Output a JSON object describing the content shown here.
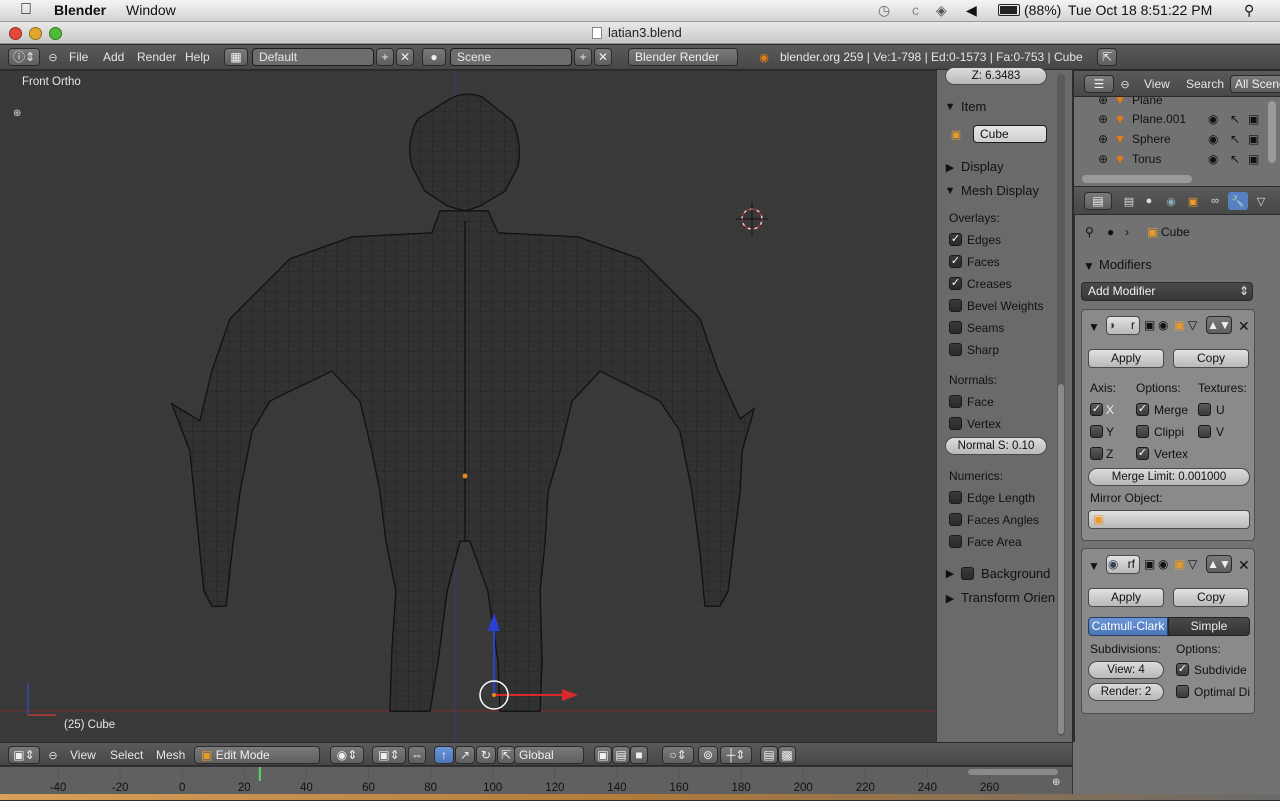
{
  "mac_menubar": {
    "app_name": "Blender",
    "menu_window": "Window",
    "battery": "(88%)",
    "clock": "Tue Oct 18  8:51:22 PM"
  },
  "window": {
    "title": "latian3.blend"
  },
  "info_header": {
    "menus": [
      "File",
      "Add",
      "Render",
      "Help"
    ],
    "layout": "Default",
    "scene": "Scene",
    "engine": "Blender Render",
    "stats": "blender.org 259 | Ve:1-798 | Ed:0-1573 | Fa:0-753 | Cube"
  },
  "viewport": {
    "view_name": "Front Ortho",
    "object_label": "(25) Cube"
  },
  "n_panel": {
    "top_field": "Z: 6.3483",
    "item_header": "Item",
    "item_name": "Cube",
    "display_header": "Display",
    "mesh_display_header": "Mesh Display",
    "overlays_label": "Overlays:",
    "overlays": [
      {
        "label": "Edges",
        "checked": true
      },
      {
        "label": "Faces",
        "checked": true
      },
      {
        "label": "Creases",
        "checked": true
      },
      {
        "label": "Bevel Weights",
        "checked": false
      },
      {
        "label": "Seams",
        "checked": false
      },
      {
        "label": "Sharp",
        "checked": false
      }
    ],
    "normals_label": "Normals:",
    "normals": [
      {
        "label": "Face",
        "checked": false
      },
      {
        "label": "Vertex",
        "checked": false
      }
    ],
    "normal_size": "Normal S: 0.10",
    "numerics_label": "Numerics:",
    "numerics": [
      {
        "label": "Edge Length",
        "checked": false
      },
      {
        "label": "Faces Angles",
        "checked": false
      },
      {
        "label": "Face Area",
        "checked": false
      }
    ],
    "background_header": "Background I",
    "transform_header": "Transform Orient"
  },
  "outliner": {
    "menus": [
      "View",
      "Search"
    ],
    "filter": "All Scene",
    "items": [
      "Plane",
      "Plane.001",
      "Sphere",
      "Torus"
    ]
  },
  "properties": {
    "breadcrumb": "Cube",
    "modifiers_header": "Modifiers",
    "add_modifier": "Add Modifier",
    "mirror": {
      "name_short": "r",
      "apply": "Apply",
      "copy": "Copy",
      "axis_label": "Axis:",
      "options_label": "Options:",
      "textures_label": "Textures:",
      "axis": [
        {
          "label": "X",
          "checked": true
        },
        {
          "label": "Y",
          "checked": false
        },
        {
          "label": "Z",
          "checked": false
        }
      ],
      "options": [
        {
          "label": "Merge",
          "checked": true
        },
        {
          "label": "Clippi",
          "checked": false
        },
        {
          "label": "Vertex",
          "checked": true
        }
      ],
      "textures": [
        {
          "label": "U",
          "checked": false
        },
        {
          "label": "V",
          "checked": false
        }
      ],
      "merge_limit": "Merge Limit: 0.001000",
      "mirror_object_label": "Mirror Object:"
    },
    "subsurf": {
      "name_short": "rf",
      "apply": "Apply",
      "copy": "Copy",
      "type_active": "Catmull-Clark",
      "type_other": "Simple",
      "subdivisions_label": "Subdivisions:",
      "options_label": "Options:",
      "view": "View: 4",
      "render": "Render: 2",
      "opt_subdivide": {
        "label": "Subdivide",
        "checked": true
      },
      "opt_optimal": {
        "label": "Optimal Di",
        "checked": false
      }
    }
  },
  "view3d_header": {
    "menus": [
      "View",
      "Select",
      "Mesh"
    ],
    "mode": "Edit Mode",
    "orientation": "Global"
  },
  "timeline": {
    "ticks": [
      "-40",
      "-20",
      "0",
      "20",
      "40",
      "60",
      "80",
      "100",
      "120",
      "140",
      "160",
      "180",
      "200",
      "220",
      "240",
      "260"
    ],
    "current_frame": 25
  },
  "colors": {
    "viewport_bg": "#393939",
    "panel_bg": "#727272",
    "accent_blue": "#5680c2",
    "mesh_wire": "#0b0b0b"
  }
}
